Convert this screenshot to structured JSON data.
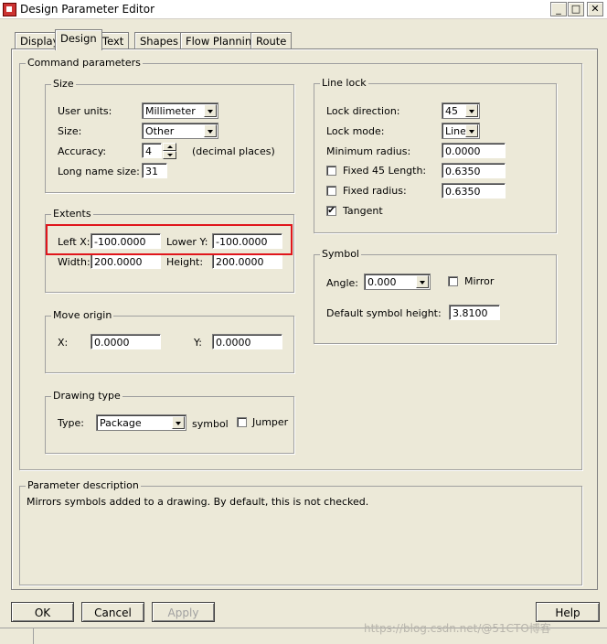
{
  "window": {
    "title": "Design Parameter Editor",
    "min": "_",
    "max": "□",
    "close": "✕"
  },
  "tabs": [
    "Display",
    "Design",
    "Text",
    "Shapes",
    "Flow Planning",
    "Route"
  ],
  "command_parameters": {
    "title": "Command parameters",
    "size": {
      "title": "Size",
      "user_units_label": "User units:",
      "user_units_value": "Millimeter",
      "size_label": "Size:",
      "size_value": "Other",
      "accuracy_label": "Accuracy:",
      "accuracy_value": "4",
      "accuracy_suffix": "(decimal places)",
      "long_name_label": "Long name size:",
      "long_name_value": "31"
    },
    "extents": {
      "title": "Extents",
      "left_x_label": "Left X:",
      "left_x_value": "-100.0000",
      "lower_y_label": "Lower Y:",
      "lower_y_value": "-100.0000",
      "width_label": "Width:",
      "width_value": "200.0000",
      "height_label": "Height:",
      "height_value": "200.0000"
    },
    "move_origin": {
      "title": "Move origin",
      "x_label": "X:",
      "x_value": "0.0000",
      "y_label": "Y:",
      "y_value": "0.0000"
    },
    "drawing_type": {
      "title": "Drawing type",
      "type_label": "Type:",
      "type_value": "Package",
      "symbol_label": "symbol",
      "jumper_label": "Jumper"
    },
    "line_lock": {
      "title": "Line lock",
      "lock_direction_label": "Lock direction:",
      "lock_direction_value": "45",
      "lock_mode_label": "Lock mode:",
      "lock_mode_value": "Line",
      "min_radius_label": "Minimum radius:",
      "min_radius_value": "0.0000",
      "fixed45_label": "Fixed 45 Length:",
      "fixed45_value": "0.6350",
      "fixed_radius_label": "Fixed radius:",
      "fixed_radius_value": "0.6350",
      "tangent_label": "Tangent",
      "tangent_checked": true
    },
    "symbol": {
      "title": "Symbol",
      "angle_label": "Angle:",
      "angle_value": "0.000",
      "mirror_label": "Mirror",
      "default_height_label": "Default symbol height:",
      "default_height_value": "3.8100"
    }
  },
  "parameter_description": {
    "title": "Parameter description",
    "text": "Mirrors symbols added to a drawing. By default, this is not checked."
  },
  "buttons": {
    "ok": "OK",
    "cancel": "Cancel",
    "apply": "Apply",
    "help": "Help"
  },
  "watermark": "https://blog.csdn.net/@51CTO博客",
  "colors": {
    "highlight": "#e0161c",
    "dialog_bg": "#ece9d8"
  }
}
